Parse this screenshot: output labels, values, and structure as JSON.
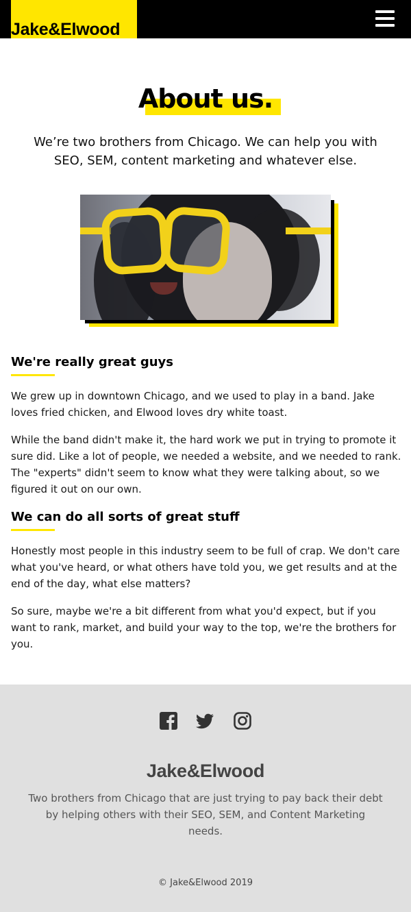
{
  "header": {
    "logo": "Jake&Elwood",
    "menu_icon": "hamburger-menu-icon"
  },
  "colors": {
    "accent": "#ffe600",
    "header_bg": "#000000",
    "footer_bg": "#e0e0e0"
  },
  "main": {
    "title": "About us.",
    "intro": "We’re two brothers from Chicago. We can help you with SEO, SEM, content marketing and whatever else.",
    "sections": [
      {
        "heading": "We're really great guys",
        "paragraphs": [
          "We grew up in downtown Chicago, and we used to play in a band. Jake loves fried chicken, and Elwood loves dry white toast.",
          "While the band didn't make it, the hard work we put in trying to promote it sure did. Like a lot of people, we needed a website, and we needed to rank. The \"experts\" didn't seem to know what they were talking about, so we figured it out on our own."
        ]
      },
      {
        "heading": "We can do all sorts of great stuff",
        "paragraphs": [
          "Honestly most people in this industry seem to be full of crap. We don't care what you've heard, or what others have told you, we get results and at the end of the day, what else matters?",
          "So sure, maybe we're a bit different from what you'd expect, but if you want to rank, market, and build your way to the top, we're the brothers for you."
        ]
      }
    ]
  },
  "footer": {
    "social_icons": [
      "facebook-icon",
      "twitter-icon",
      "instagram-icon"
    ],
    "logo": "Jake&Elwood",
    "description": "Two brothers from Chicago that are just trying to pay back their debt by helping others with their SEO, SEM, and Content Marketing needs.",
    "copyright": "© Jake&Elwood 2019"
  }
}
